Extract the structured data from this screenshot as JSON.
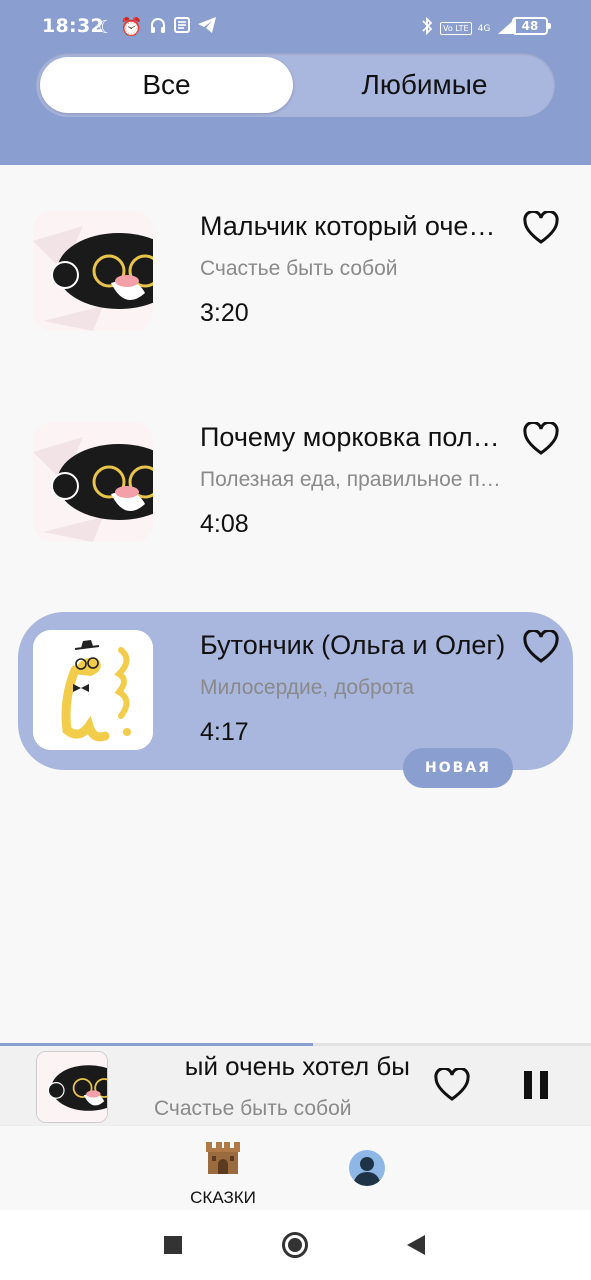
{
  "status_bar": {
    "time": "18:32",
    "battery": "48",
    "left_icons": [
      "moon-icon",
      "alarm-icon",
      "headphones-icon",
      "news-icon",
      "telegram-icon"
    ],
    "right_icons": [
      "bluetooth-icon",
      "volte-icon",
      "signal-4g-icon",
      "signal-icon"
    ],
    "volte_text": "Vo LTE",
    "net_text": "4G"
  },
  "tabs": {
    "all_label": "Все",
    "favorites_label": "Любимые",
    "selected": "all"
  },
  "tracks": [
    {
      "title": "Мальчик который очень хотел быть собой",
      "subtitle": "Счастье быть собой",
      "duration": "3:20",
      "favorite": false,
      "playing": false,
      "cover": "monkey-glasses"
    },
    {
      "title": "Почему морковка полезна",
      "subtitle": "Полезная еда, правильное питание",
      "duration": "4:08",
      "favorite": false,
      "playing": false,
      "cover": "monkey-glasses"
    },
    {
      "title": "Бутончик  (Ольга и Олег)",
      "subtitle": "Милосердие, доброта",
      "duration": "4:17",
      "favorite": false,
      "playing": true,
      "badge": "НОВАЯ",
      "cover": "yellow-snake"
    }
  ],
  "player": {
    "title_visible": "ый очень хотел бы",
    "subtitle": "Счастье быть собой",
    "progress_fraction": 0.53,
    "state": "playing"
  },
  "bottom_nav": {
    "tales_label": "СКАЗКИ"
  },
  "colors": {
    "accent": "#8a9ed0",
    "accent_light": "#a9b6de",
    "background": "#f8f8f8"
  }
}
